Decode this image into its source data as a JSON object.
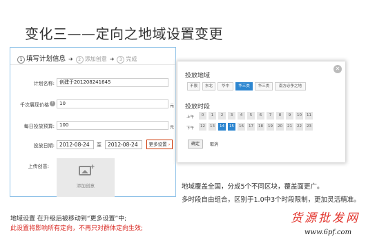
{
  "slide_title": "变化三——定向之地域设置变更",
  "form": {
    "steps": [
      {
        "num": "1",
        "label": "填写计划信息"
      },
      {
        "num": "2",
        "label": "添加创意"
      },
      {
        "num": "3",
        "label": "完成"
      }
    ],
    "plan_name_label": "计划名称:",
    "plan_name_value": "创建于201208241645",
    "bid_label": "千次展现价格",
    "bid_value": "10",
    "bid_unit": "元",
    "budget_label": "每日投放预算:",
    "budget_value": "100",
    "budget_unit": "元",
    "date_label": "投放日期:",
    "date_start": "2012-08-24",
    "date_to": "至",
    "date_end": "2012-08-24",
    "more_settings": "更多设置",
    "upload_label": "上传创意:",
    "upload_text": "添加创意"
  },
  "targeting": {
    "region_title": "投放地域",
    "regions": [
      "不限",
      "东北",
      "华中",
      "华三类",
      "华三类",
      "南方必争之地"
    ],
    "selected_region": "华三类",
    "time_title": "投放时段",
    "am_label": "上午",
    "pm_label": "下午",
    "am_hours": [
      "0",
      "1",
      "2",
      "3",
      "4",
      "5",
      "6",
      "7",
      "8",
      "9",
      "10",
      "11"
    ],
    "pm_hours": [
      "12",
      "13",
      "14",
      "15",
      "16",
      "17",
      "18",
      "19",
      "20",
      "21",
      "22",
      "23"
    ],
    "selected_hours": [
      "14",
      "15"
    ],
    "ok": "确定",
    "cancel": "取消"
  },
  "notes": {
    "right_line1": "地域覆盖全国，分成5个不同区块，覆盖面更广。",
    "right_line2": "多时段自由组合，区别于1.0中3个时段限制，更加灵活精准。",
    "bottom_line1": "地域设置 在升级后被移动到“更多设置”中;",
    "bottom_line2": "此设置将影响所有定向，不再只对群体定向生效;",
    "bottom_line1_color": "#333333",
    "bottom_line2_color": "#d8261f"
  },
  "watermark": {
    "brand": "货源批发网",
    "url": "www.6pf.com"
  }
}
